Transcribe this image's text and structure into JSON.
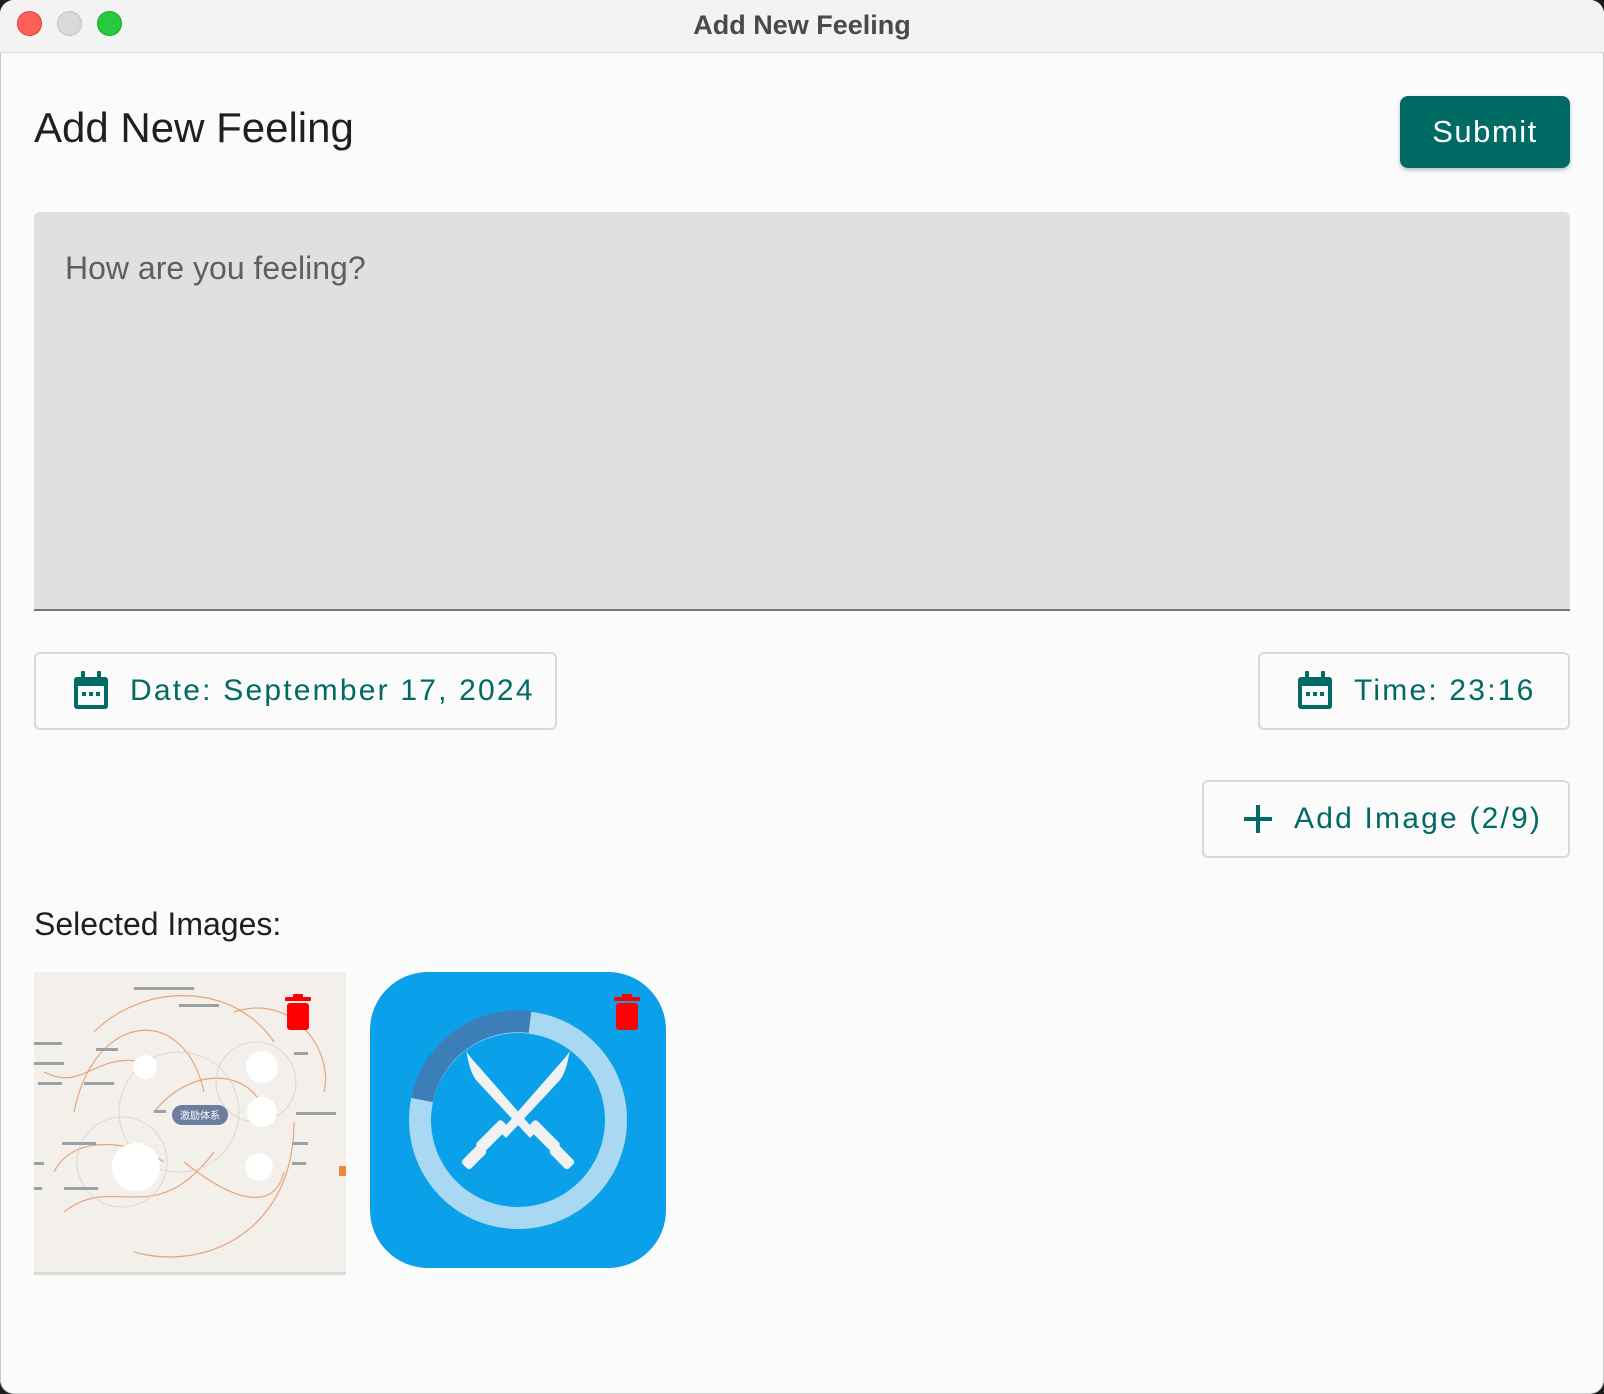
{
  "window": {
    "title": "Add New Feeling"
  },
  "header": {
    "title": "Add New Feeling",
    "submit_label": "Submit"
  },
  "feeling_input": {
    "placeholder": "How are you feeling?",
    "value": ""
  },
  "date_button": {
    "label": "Date: September 17, 2024",
    "icon": "calendar-icon"
  },
  "time_button": {
    "label": "Time: 23:16",
    "icon": "calendar-icon"
  },
  "add_image_button": {
    "label": "Add Image (2/9)",
    "icon": "plus-icon"
  },
  "selected_images": {
    "label": "Selected Images:",
    "items": [
      {
        "kind": "mind-map-thumbnail",
        "center_text": "激励体系",
        "delete_icon": "trash-icon"
      },
      {
        "kind": "crossed-swords-app-icon",
        "delete_icon": "trash-icon"
      }
    ]
  },
  "colors": {
    "accent": "#006a64",
    "delete": "#ff0000",
    "field_bg": "#e0e1df",
    "app_icon_blue": "#0aa0ea"
  }
}
